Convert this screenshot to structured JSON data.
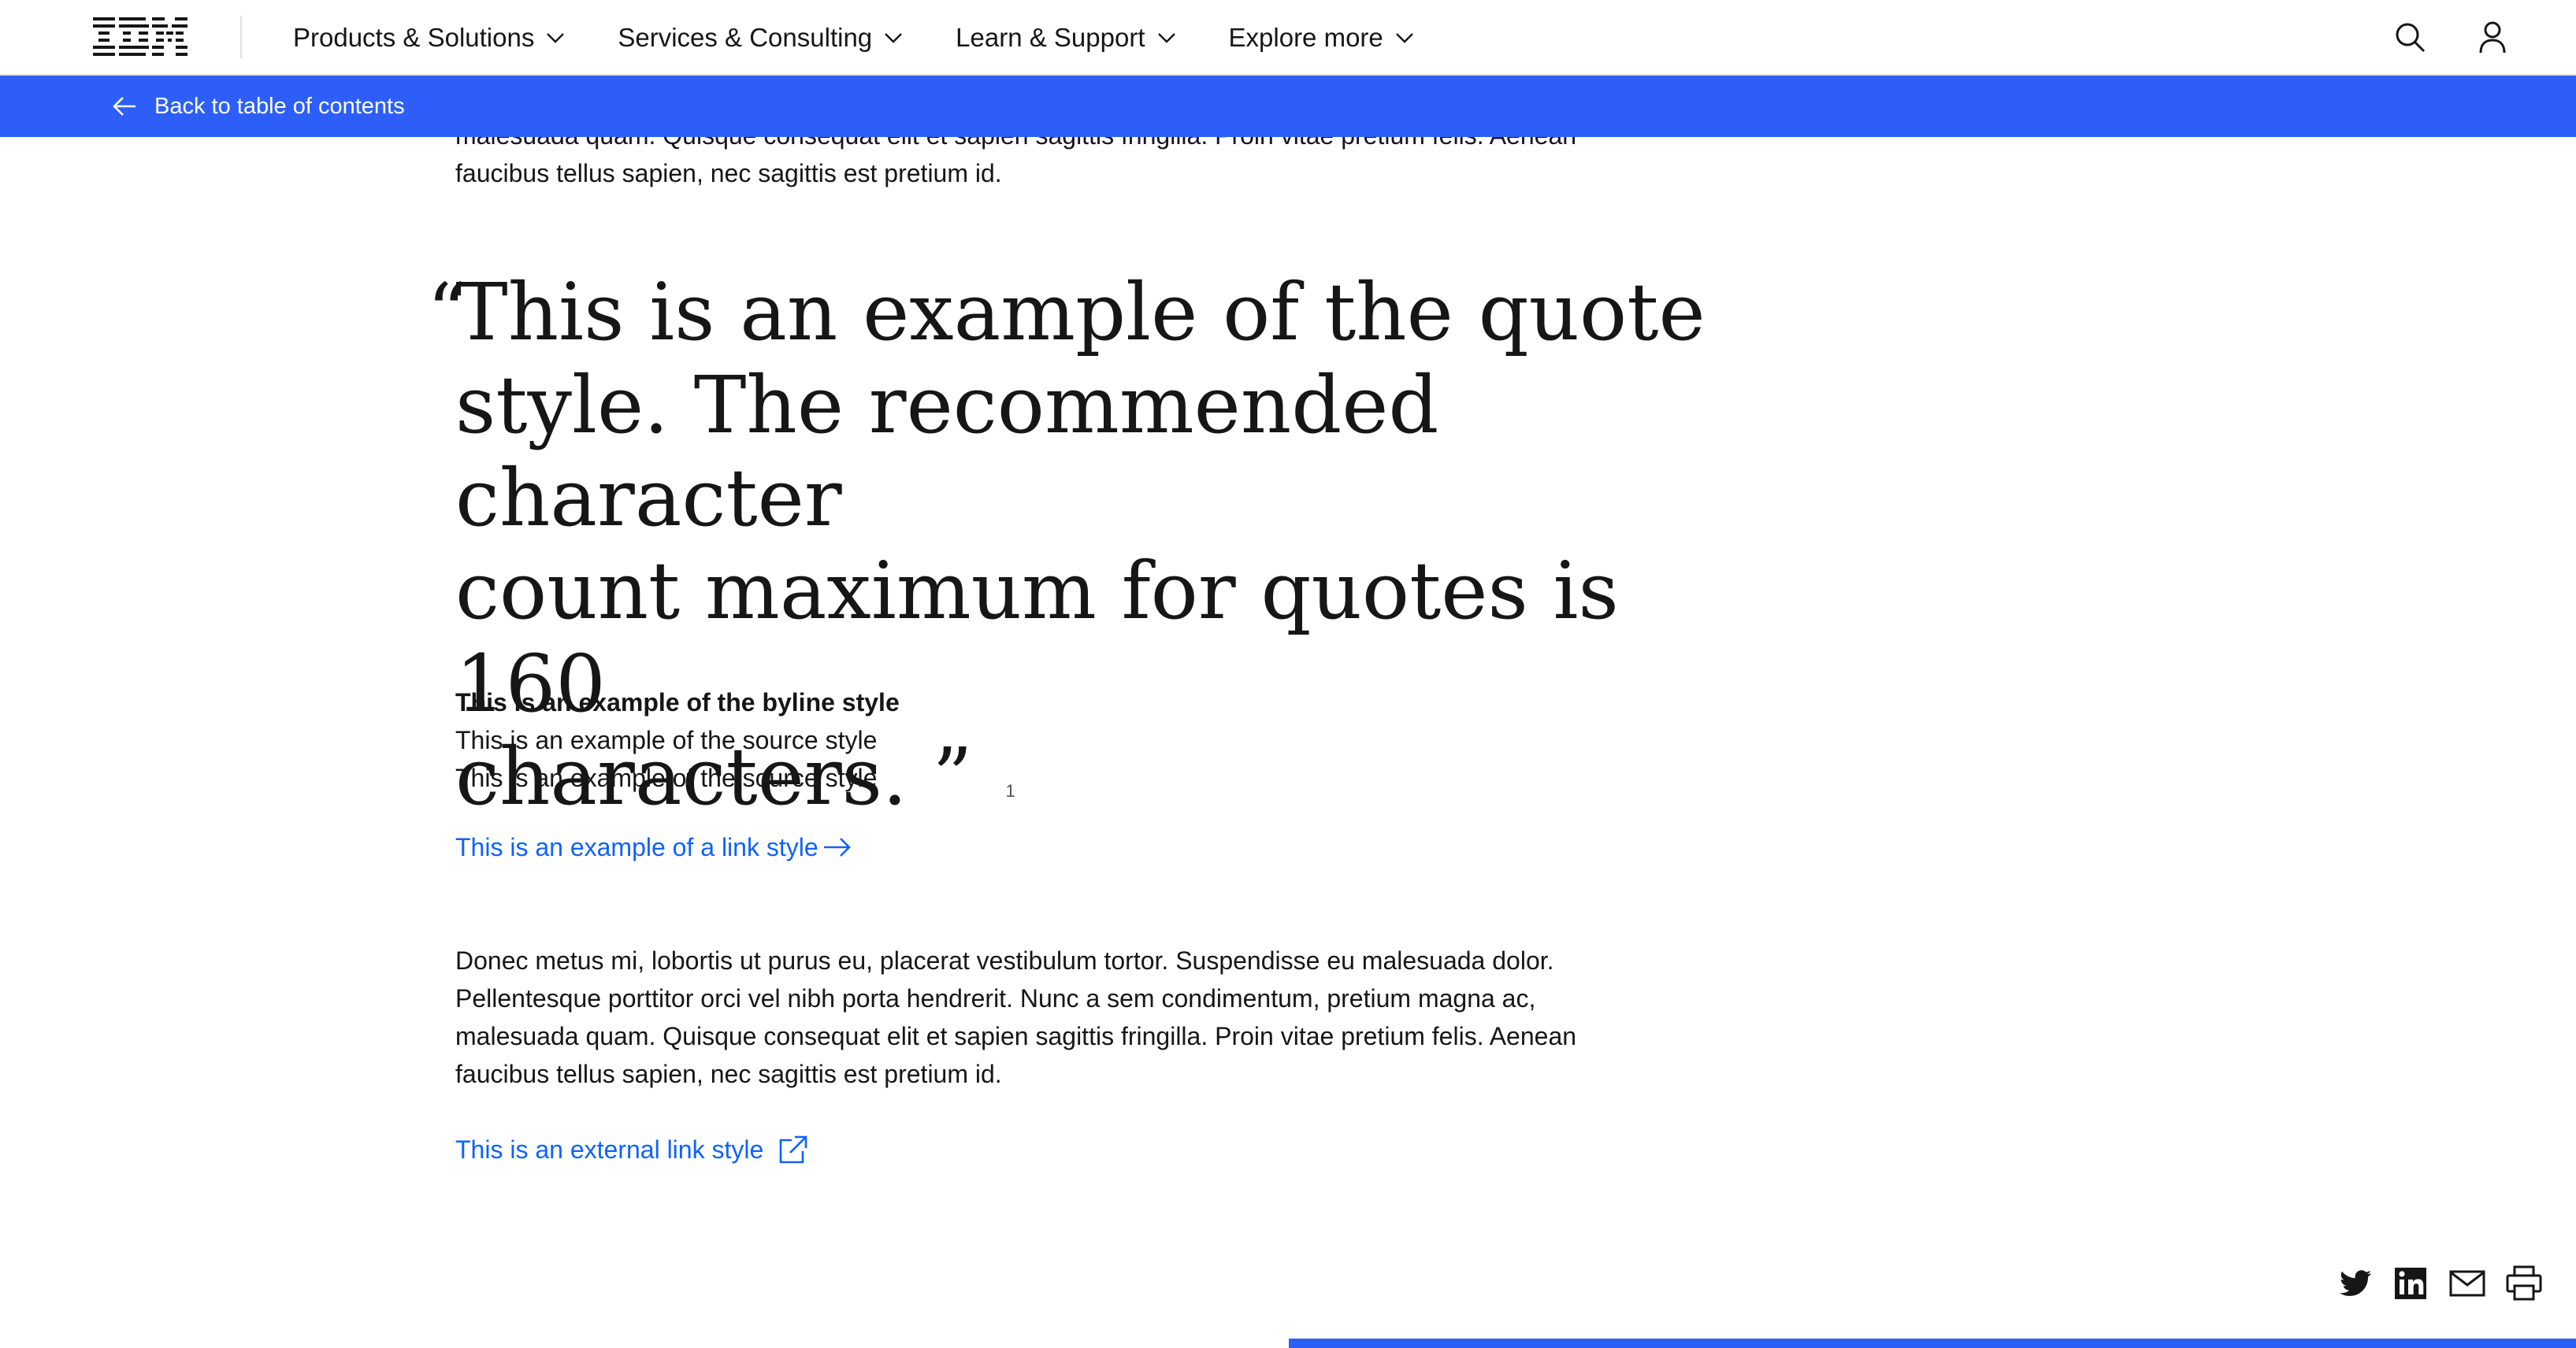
{
  "masthead": {
    "logo_text": "IBM",
    "nav": [
      {
        "label": "Products & Solutions"
      },
      {
        "label": "Services & Consulting"
      },
      {
        "label": "Learn & Support"
      },
      {
        "label": "Explore more"
      }
    ],
    "icons": [
      "search-icon",
      "user-icon"
    ]
  },
  "backbar": {
    "label": "Back to table of contents",
    "color": "#2d5ff8"
  },
  "article": {
    "para_top_line1": "malesuada quam. Quisque consequat elit et sapien sagittis fringilla. Proin vitae pretium felis. Aenean",
    "para_top_line2": "faucibus tellus sapien, nec sagittis est pretium id.",
    "quote": {
      "open_mark": "“",
      "line1": "This is an example of the quote",
      "line2": "style. The recommended character",
      "line3": "count maximum for quotes is 160",
      "line4": "characters.",
      "close_mark": "”",
      "footnote": "1"
    },
    "byline": "This is an example of the byline style",
    "source1": "This is an example of the source style",
    "source2": "This is an example of the source style",
    "link_label": "This is an example of a link style",
    "para_bottom": [
      "Donec metus mi, lobortis ut purus eu, placerat vestibulum tortor. Suspendisse eu malesuada dolor.",
      "Pellentesque porttitor orci vel nibh porta hendrerit. Nunc a sem condimentum, pretium magna ac,",
      "malesuada quam. Quisque consequat elit et sapien sagittis fringilla. Proin vitae pretium felis. Aenean",
      "faucibus tellus sapien, nec sagittis est pretium id."
    ],
    "external_link_label": "This is an external link style",
    "link_color": "#0f62fe"
  },
  "share": {
    "icons": [
      "twitter-icon",
      "linkedin-icon",
      "email-icon",
      "print-icon"
    ]
  }
}
